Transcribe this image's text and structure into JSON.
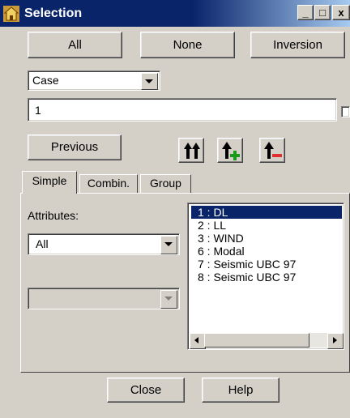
{
  "window": {
    "title": "Selection",
    "icon": "house-icon"
  },
  "titlebar_buttons": {
    "minimize": "_",
    "maximize": "□",
    "close": "x"
  },
  "selection_buttons": {
    "all": "All",
    "none": "None",
    "inversion": "Inversion"
  },
  "type_dropdown": {
    "value": "Case"
  },
  "case_input": {
    "value": "1"
  },
  "previous_button": "Previous",
  "icons": {
    "move_top": "double-up-arrow-icon",
    "add": "up-arrow-plus-icon",
    "remove": "up-arrow-minus-icon"
  },
  "tabs": [
    {
      "label": "Simple"
    },
    {
      "label": "Combin."
    },
    {
      "label": "Group"
    }
  ],
  "attributes": {
    "label": "Attributes:",
    "value": "All",
    "second_value": ""
  },
  "case_list": {
    "items": [
      "1 : DL",
      "2 : LL",
      "3 : WIND",
      "6 : Modal",
      "7 : Seismic UBC 97",
      "8 : Seismic UBC 97"
    ],
    "selected_index": 0
  },
  "footer": {
    "close": "Close",
    "help": "Help"
  },
  "colors": {
    "titlebar": "#0a246a",
    "selection": "#0a246a",
    "face": "#d4d0c8",
    "add_green": "#1a9a1a",
    "remove_red": "#e03030"
  }
}
